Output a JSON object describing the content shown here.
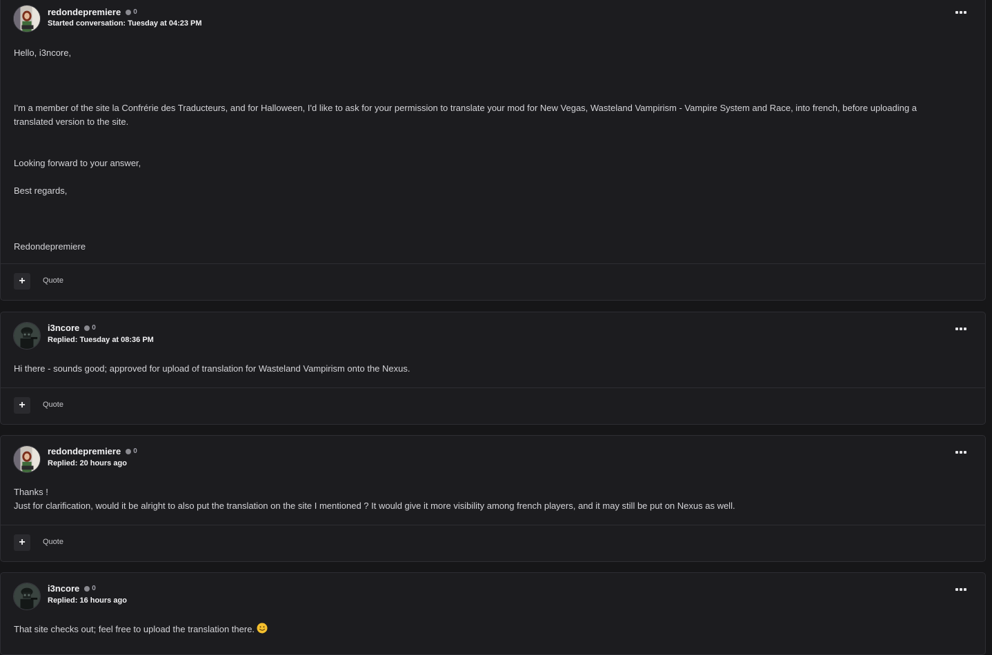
{
  "posts": [
    {
      "author": "redondepremiere",
      "reputation": "0",
      "meta": "Started conversation: Tuesday at 04:23 PM",
      "avatar": "woman-avatar",
      "paragraphs": [
        "Hello, i3ncore,",
        "I'm a member of the site la Confrérie des Traducteurs, and for Halloween, I'd like to ask for your permission to translate your mod for New Vegas, Wasteland Vampirism - Vampire System and Race, into french, before uploading a translated version to the site.",
        "Looking forward to your answer,",
        "Best regards,",
        "Redondepremiere"
      ],
      "quote_label": "Quote"
    },
    {
      "author": "i3ncore",
      "reputation": "0",
      "meta": "Replied: Tuesday at 08:36 PM",
      "avatar": "soldier-avatar",
      "paragraphs": [
        "Hi there - sounds good; approved for upload of translation for Wasteland Vampirism onto the Nexus."
      ],
      "quote_label": "Quote"
    },
    {
      "author": "redondepremiere",
      "reputation": "0",
      "meta": "Replied: 20 hours ago",
      "avatar": "woman-avatar",
      "paragraphs": [
        "Thanks !",
        "Just for clarification, would it be alright to also put the translation on the site I mentioned ? It would give it more visibility among french players, and it may still be put on Nexus as well."
      ],
      "quote_label": "Quote"
    },
    {
      "author": "i3ncore",
      "reputation": "0",
      "meta": "Replied: 16 hours ago",
      "avatar": "soldier-avatar",
      "paragraphs": [
        "That site checks out; feel free to upload the translation there."
      ],
      "emoji": "smiley-emoji"
    }
  ],
  "colors": {
    "background": "#161618",
    "card": "#1c1c1f",
    "border": "#2e2e33",
    "emoji": "#f5c02e"
  }
}
